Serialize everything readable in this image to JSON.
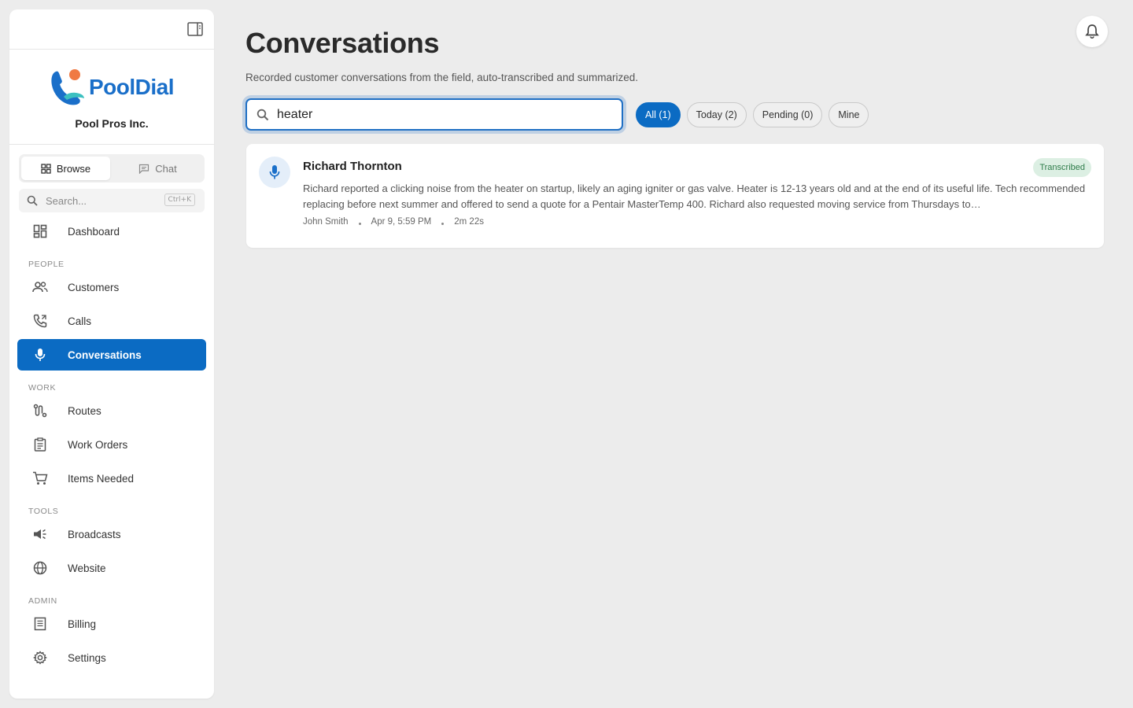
{
  "sidebar": {
    "brand_name": "PoolDial",
    "org_name": "Pool Pros Inc.",
    "modes": {
      "browse": "Browse",
      "chat": "Chat"
    },
    "search": {
      "placeholder": "Search...",
      "shortcut": "Ctrl+K"
    },
    "dashboard": "Dashboard",
    "sections": {
      "people": "PEOPLE",
      "work": "WORK",
      "tools": "TOOLS",
      "admin": "ADMIN"
    },
    "items": {
      "customers": "Customers",
      "calls": "Calls",
      "conversations": "Conversations",
      "routes": "Routes",
      "work_orders": "Work Orders",
      "items_needed": "Items Needed",
      "broadcasts": "Broadcasts",
      "website": "Website",
      "billing": "Billing",
      "settings": "Settings"
    }
  },
  "main": {
    "title": "Conversations",
    "subtitle": "Recorded customer conversations from the field, auto-transcribed and summarized.",
    "search_value": "heater",
    "filters": [
      "All (1)",
      "Today (2)",
      "Pending (0)",
      "Mine"
    ],
    "active_filter": "All (1)",
    "conversations": [
      {
        "name": "Richard Thornton",
        "status": "Transcribed",
        "summary": "Richard reported a clicking noise from the heater on startup, likely an aging igniter or gas valve. Heater is 12-13 years old and at the end of its useful life. Tech recommended replacing before next summer and offered to send a quote for a Pentair MasterTemp 400. Richard also requested moving service from Thursdays to…",
        "technician": "John Smith",
        "datetime": "Apr 9, 5:59 PM",
        "duration": "2m 22s"
      }
    ]
  },
  "colors": {
    "accent": "#0b6bc3",
    "background": "#ececec",
    "badge_bg": "#dcefe3",
    "badge_text": "#2f7d4b"
  }
}
